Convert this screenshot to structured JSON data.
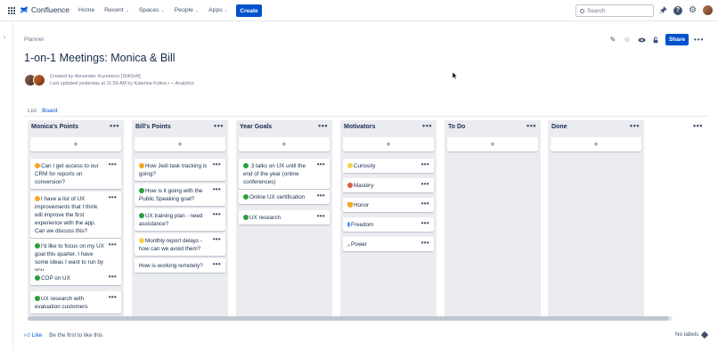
{
  "topnav": {
    "product": "Confluence",
    "items": [
      {
        "label": "Home",
        "dropdown": false
      },
      {
        "label": "Recent",
        "dropdown": true
      },
      {
        "label": "Spaces",
        "dropdown": true
      },
      {
        "label": "People",
        "dropdown": true
      },
      {
        "label": "Apps",
        "dropdown": true
      }
    ],
    "create_label": "Create",
    "search_placeholder": "Search",
    "brand_color": "#0052cc"
  },
  "breadcrumb": "Planner",
  "page_actions": {
    "share_label": "Share"
  },
  "page": {
    "title": "1-on-1 Meetings: Monica & Bill",
    "created_by": "Created by Alexander Kuznetsov [StiltSoft]",
    "last_updated": "Last updated yesterday at 11:59 AM by Katerina Kolina",
    "analytics": "Analytics"
  },
  "view_tabs": [
    "List",
    "Board"
  ],
  "active_tab": "Board",
  "board": {
    "columns": [
      {
        "title": "Monica's Points",
        "cards": [
          {
            "emoji": "orange",
            "text": "Can I get access to our CRM for reports on conversion?"
          },
          {
            "emoji": "orange",
            "text": "I have a list of UX improvements that I think will improve the first experience with the app. Can we discuss this?"
          },
          {
            "emoji": "green",
            "text": "I'd like to focus on my UX goal this quarter. I have some ideas I want to run by you"
          },
          {
            "emoji": "green",
            "text": "COP on UX"
          },
          {
            "emoji": "green",
            "text": "UX research with evaluation customers"
          }
        ]
      },
      {
        "title": "Bill's Points",
        "cards": [
          {
            "emoji": "orange",
            "text": "How Jedi task tracking is going?"
          },
          {
            "emoji": "green",
            "text": "How is it going with the Public Speaking goal?"
          },
          {
            "emoji": "green",
            "text": "UX training plan - need assistance?"
          },
          {
            "emoji": "yellow",
            "text": "Monthly report delays - how can we avoid them?"
          },
          {
            "emoji": "",
            "text": "How is working remotely?"
          }
        ]
      },
      {
        "title": "Year Goals",
        "cards": [
          {
            "emoji": "green",
            "text": " 3 talks on UX until the end of the year (online conferences)"
          },
          {
            "emoji": "green",
            "text": "Online UX certification"
          },
          {
            "emoji": "green",
            "text": "UX research"
          }
        ]
      },
      {
        "title": "Motivators",
        "cards": [
          {
            "emoji": "yellow",
            "text": "Curiosity"
          },
          {
            "emoji": "red",
            "text": "Mastery"
          },
          {
            "emoji": "heart",
            "text": "Honor"
          },
          {
            "emoji": "blue",
            "text": "Freedom"
          },
          {
            "emoji": "grey",
            "text": "Power"
          }
        ]
      },
      {
        "title": "To Do",
        "cards": []
      },
      {
        "title": "Done",
        "cards": []
      }
    ]
  },
  "footer": {
    "like_label": "Like",
    "like_prompt": "Be the first to like this",
    "labels": "No labels"
  }
}
